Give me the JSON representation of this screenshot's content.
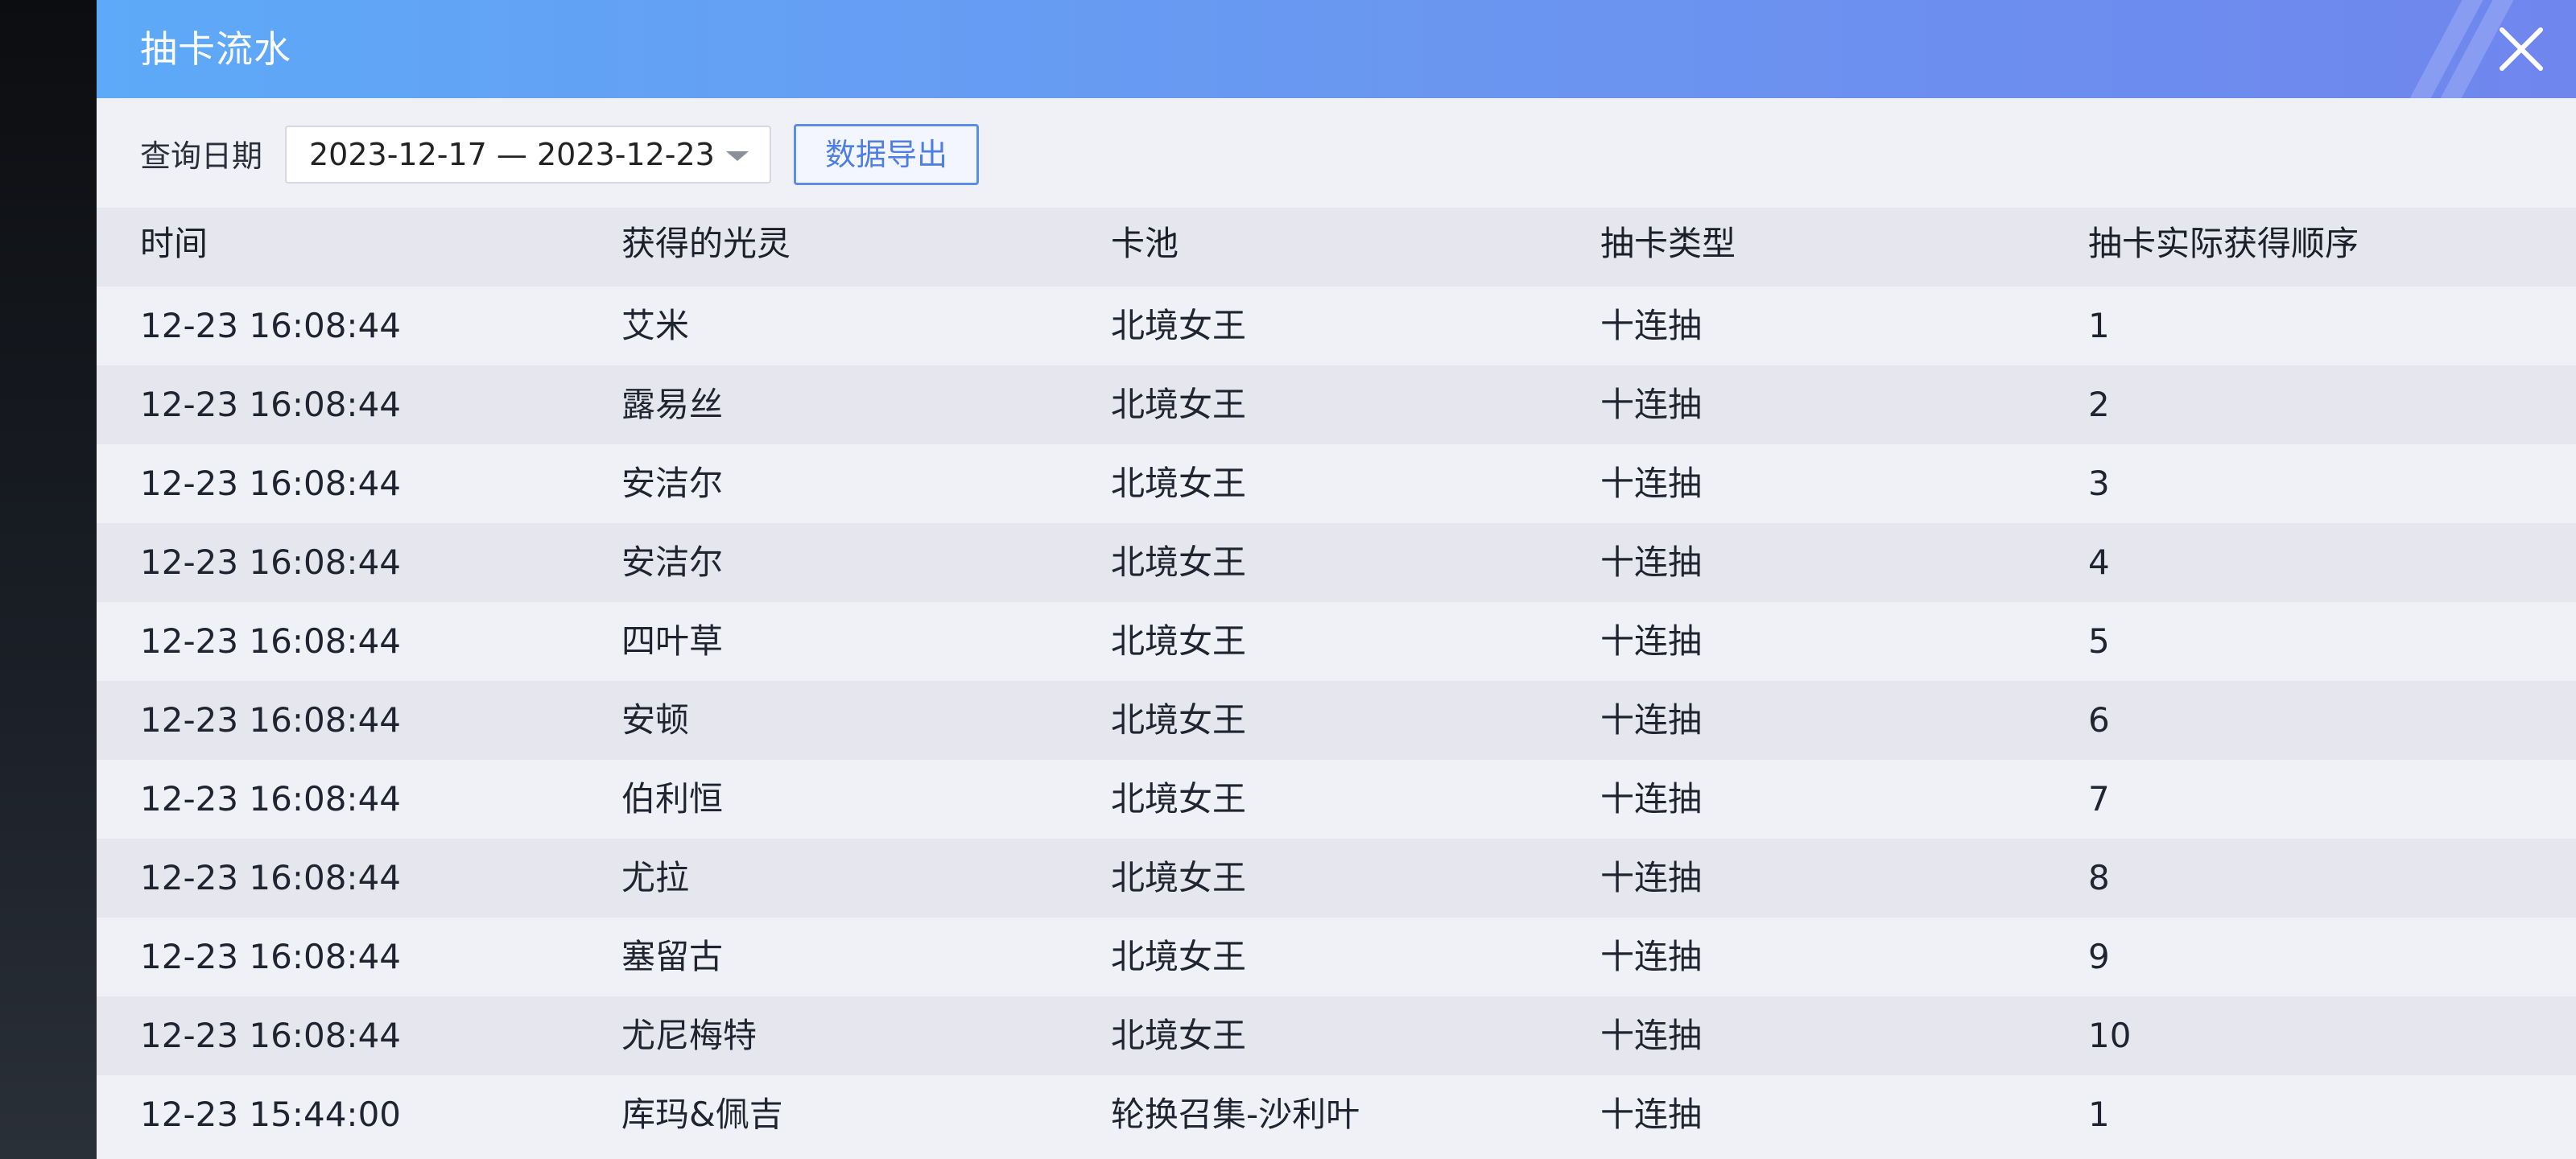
{
  "window": {
    "title": "抽卡流水",
    "close_icon": "close-icon"
  },
  "filter": {
    "date_label": "查询日期",
    "date_range": "2023-12-17 — 2023-12-23",
    "export_label": "数据导出"
  },
  "table": {
    "headers": [
      "时间",
      "获得的光灵",
      "卡池",
      "抽卡类型",
      "抽卡实际获得顺序"
    ],
    "rows": [
      [
        "12-23 16:08:44",
        "艾米",
        "北境女王",
        "十连抽",
        "1"
      ],
      [
        "12-23 16:08:44",
        "露易丝",
        "北境女王",
        "十连抽",
        "2"
      ],
      [
        "12-23 16:08:44",
        "安洁尔",
        "北境女王",
        "十连抽",
        "3"
      ],
      [
        "12-23 16:08:44",
        "安洁尔",
        "北境女王",
        "十连抽",
        "4"
      ],
      [
        "12-23 16:08:44",
        "四叶草",
        "北境女王",
        "十连抽",
        "5"
      ],
      [
        "12-23 16:08:44",
        "安顿",
        "北境女王",
        "十连抽",
        "6"
      ],
      [
        "12-23 16:08:44",
        "伯利恒",
        "北境女王",
        "十连抽",
        "7"
      ],
      [
        "12-23 16:08:44",
        "尤拉",
        "北境女王",
        "十连抽",
        "8"
      ],
      [
        "12-23 16:08:44",
        "塞留古",
        "北境女王",
        "十连抽",
        "9"
      ],
      [
        "12-23 16:08:44",
        "尤尼梅特",
        "北境女王",
        "十连抽",
        "10"
      ],
      [
        "12-23 15:44:00",
        "库玛&佩吉",
        "轮换召集-沙利叶",
        "十连抽",
        "1"
      ]
    ]
  },
  "colors": {
    "title_gradient_start": "#5ea9f8",
    "title_gradient_end": "#6f86ee",
    "accent": "#4f7fe2"
  }
}
